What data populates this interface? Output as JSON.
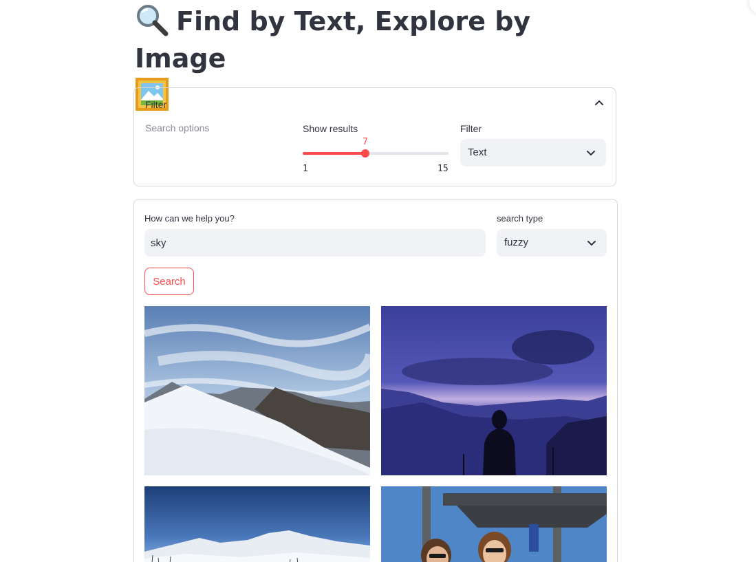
{
  "header": {
    "title": "Find by Text, Explore by Image",
    "title_icons": [
      "magnifier-icon",
      "framed-picture-icon"
    ]
  },
  "filter_expander": {
    "label": "Filter",
    "expanded": true,
    "search_options_label": "Search options",
    "show_results": {
      "label": "Show results",
      "value": "7",
      "min": "1",
      "max": "15"
    },
    "filter": {
      "label": "Filter",
      "selected": "Text"
    }
  },
  "search_form": {
    "query_label": "How can we help you?",
    "query_value": "sky",
    "search_type_label": "search type",
    "search_type_selected": "fuzzy",
    "search_button": "Search"
  },
  "results": [
    {
      "name": "snowy-mountain-sky-image"
    },
    {
      "name": "purple-dusk-mountain-silhouette-image"
    },
    {
      "name": "blue-sky-snowy-hills-image"
    },
    {
      "name": "ski-lift-people-image"
    }
  ],
  "colors": {
    "accent": "#ff4b4b",
    "input_bg": "#f0f2f6",
    "text": "#31333f",
    "border": "#d6d6d9"
  }
}
